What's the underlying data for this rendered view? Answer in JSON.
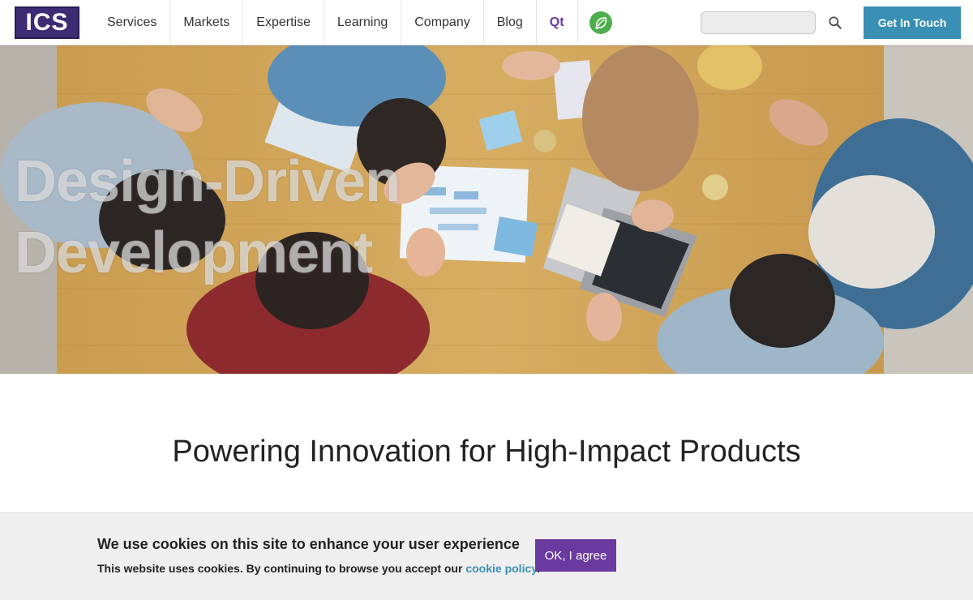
{
  "nav": {
    "logo_text": "ICS",
    "items": [
      {
        "label": "Services"
      },
      {
        "label": "Markets"
      },
      {
        "label": "Expertise"
      },
      {
        "label": "Learning"
      },
      {
        "label": "Company"
      },
      {
        "label": "Blog"
      },
      {
        "label": "Qt"
      }
    ],
    "leaf_icon": "leaf-icon",
    "search_placeholder": "",
    "search_icon": "search-icon",
    "cta_label": "Get In Touch"
  },
  "hero": {
    "title_line1": "Design-Driven",
    "title_line2": "Development"
  },
  "main": {
    "title": "Powering Innovation for High-Impact Products"
  },
  "cookie": {
    "heading": "We use cookies on this site to enhance your user experience",
    "text_before_link": "This website uses cookies. By continuing to browse you accept our ",
    "link_label": "cookie policy",
    "text_after_link": ".",
    "agree_label": "OK, I agree"
  },
  "colors": {
    "brand_purple": "#3d2b73",
    "accent_blue": "#3a8fb5",
    "agree_purple": "#6a3aa0"
  }
}
